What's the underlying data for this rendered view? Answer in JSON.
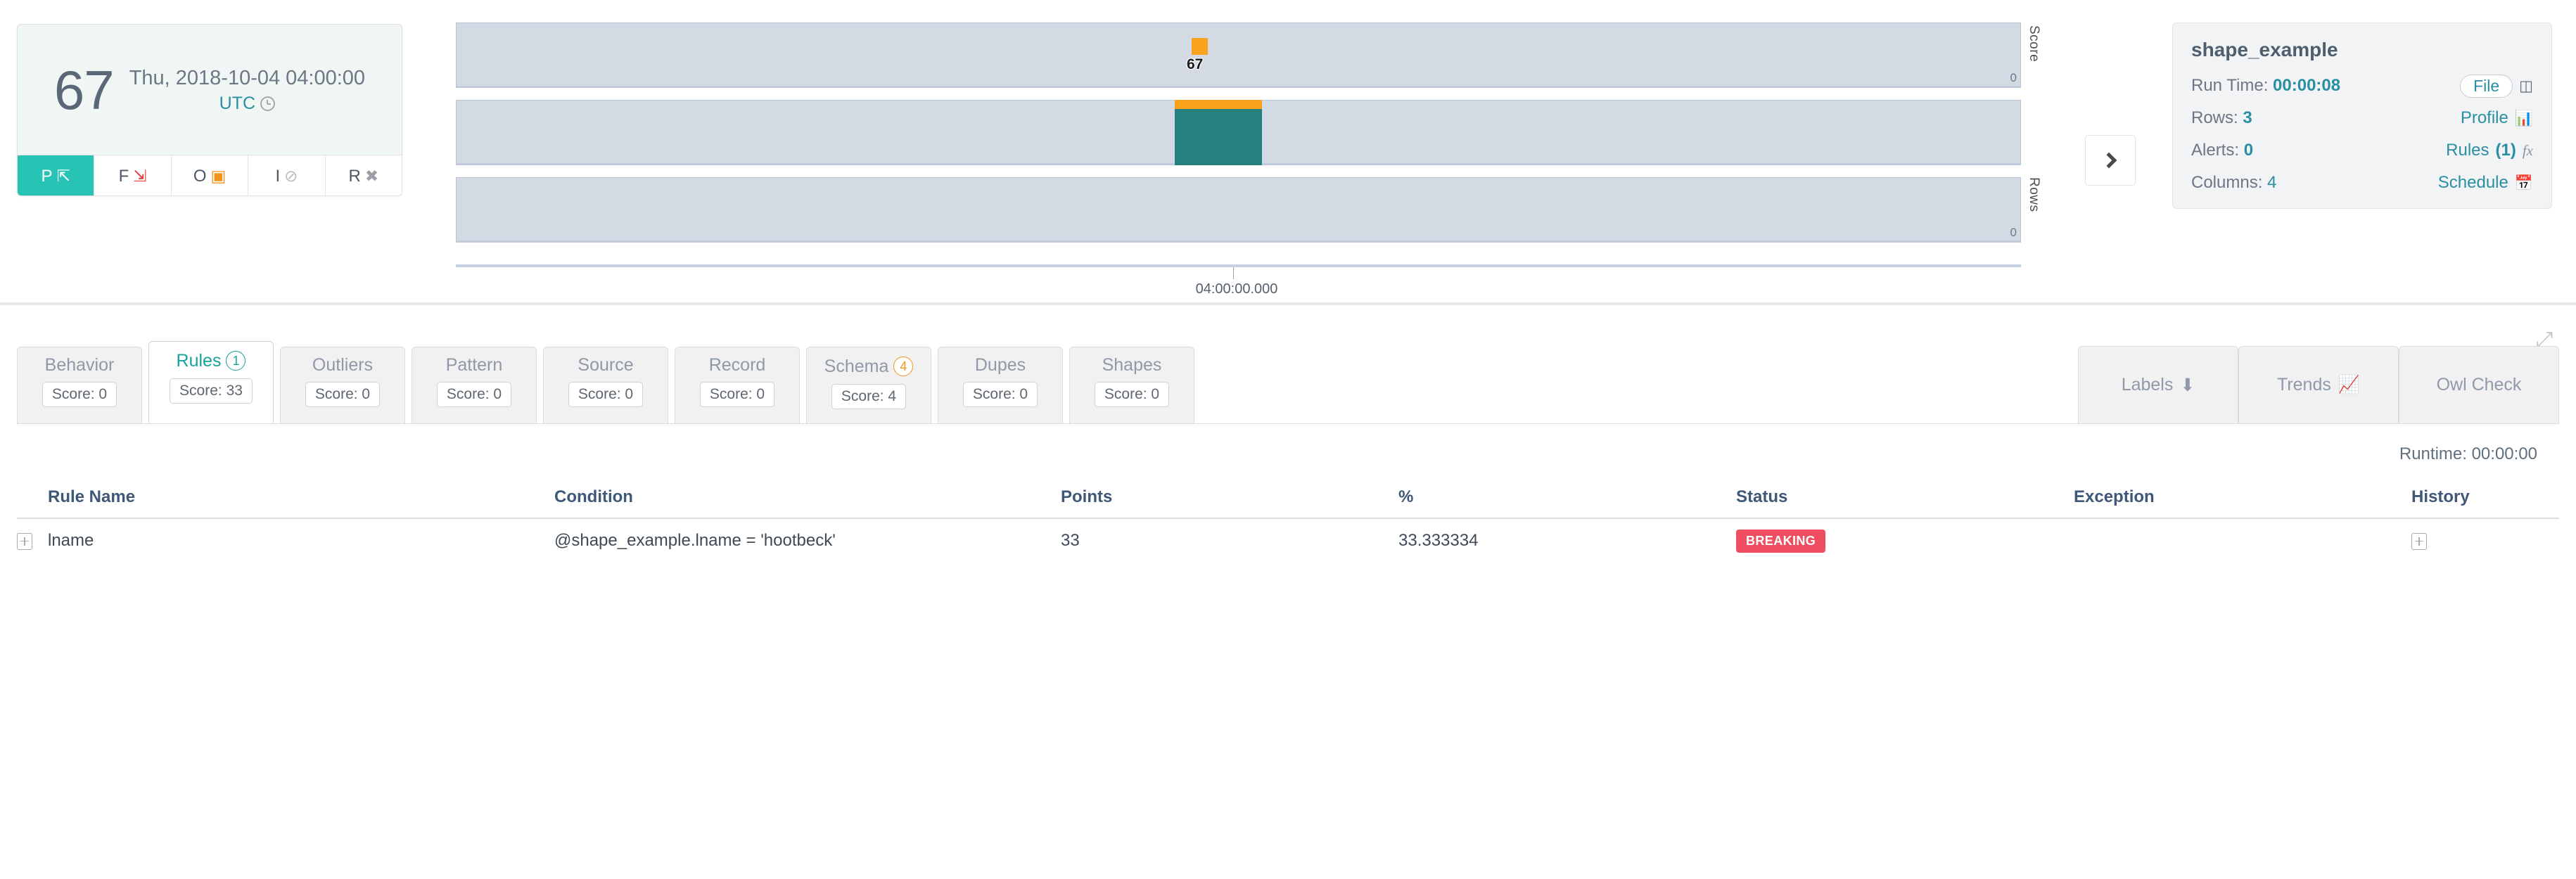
{
  "score_card": {
    "score": "67",
    "datetime": "Thu, 2018-10-04 04:00:00",
    "timezone": "UTC",
    "clock_icon": "clock-icon",
    "tabs": [
      {
        "label": "P",
        "icon": "arrow-up-right-icon",
        "glyph": "⤴",
        "active": true
      },
      {
        "label": "F",
        "icon": "arrow-down-red-icon",
        "glyph": "⤵",
        "active": false
      },
      {
        "label": "O",
        "icon": "calendar-x-icon",
        "glyph": "Ὄ5",
        "active": false
      },
      {
        "label": "I",
        "icon": "eye-slash-icon",
        "glyph": "ø",
        "active": false
      },
      {
        "label": "R",
        "icon": "close-x-icon",
        "glyph": "✖",
        "active": false
      }
    ]
  },
  "dataset_card": {
    "title": "shape_example",
    "rows": [
      {
        "label": "Run Time:",
        "value": "00:00:08",
        "action": "File",
        "action_type": "pill",
        "icon": "database-icon"
      },
      {
        "label": "Rows:",
        "value": "3",
        "action": "Profile",
        "action_type": "link",
        "icon": "bar-chart-icon"
      },
      {
        "label": "Alerts:",
        "value": "0",
        "action": "Rules",
        "action_count": "(1)",
        "action_type": "link",
        "icon": "fx-icon"
      },
      {
        "label": "Columns:",
        "value": "4",
        "value_plain": true,
        "action": "Schedule",
        "action_type": "link",
        "icon": "calendar-icon"
      }
    ]
  },
  "chart_data": {
    "type": "bar",
    "title": "",
    "xlabel": "",
    "x_tick_labels": [
      "04:00:00.000"
    ],
    "panels": [
      {
        "name": "Score",
        "ylabel": "Score",
        "ytick_label": "0",
        "ylim": [
          0,
          100
        ],
        "value": 67,
        "marker_label": "67",
        "marker_color": "#faa21b",
        "series_type": "scatter"
      },
      {
        "name": "Middle",
        "ylabel": "",
        "ytick_label": "",
        "value": 3,
        "bar_color": "#25807f",
        "cap_color": "#faa21b",
        "series_type": "bar"
      },
      {
        "name": "Rows",
        "ylabel": "Rows",
        "ytick_label": "0",
        "ylim": [
          0,
          3
        ],
        "value": 0,
        "series_type": "bar"
      }
    ],
    "grid": false,
    "legend": "none",
    "band_background": "#d3dae3"
  },
  "chart_controls": {
    "next_label": "next-period",
    "next_icon": "chevron-right-icon"
  },
  "tabs_section": {
    "expand_icon": "expand-arrows-icon",
    "tabs": [
      {
        "label": "Behavior",
        "score": "Score: 0",
        "badge": null,
        "active": false
      },
      {
        "label": "Rules",
        "score": "Score: 33",
        "badge": "1",
        "badge_color": "teal",
        "active": true
      },
      {
        "label": "Outliers",
        "score": "Score: 0",
        "badge": null,
        "active": false
      },
      {
        "label": "Pattern",
        "score": "Score: 0",
        "badge": null,
        "active": false
      },
      {
        "label": "Source",
        "score": "Score: 0",
        "badge": null,
        "active": false
      },
      {
        "label": "Record",
        "score": "Score: 0",
        "badge": null,
        "active": false
      },
      {
        "label": "Schema",
        "score": "Score: 4",
        "badge": "4",
        "badge_color": "orange",
        "active": false
      },
      {
        "label": "Dupes",
        "score": "Score: 0",
        "badge": null,
        "active": false
      },
      {
        "label": "Shapes",
        "score": "Score: 0",
        "badge": null,
        "active": false
      }
    ],
    "actions": [
      {
        "label": "Labels",
        "icon": "arrow-down-icon",
        "glyph": "⬇"
      },
      {
        "label": "Trends",
        "icon": "line-chart-icon",
        "glyph": "Ὄ8"
      },
      {
        "label": "Owl Check",
        "icon": null,
        "glyph": ""
      }
    ],
    "runtime": "Runtime: 00:00:00"
  },
  "rules_table": {
    "columns": [
      "Rule Name",
      "Condition",
      "Points",
      "%",
      "Status",
      "Exception",
      "History"
    ],
    "rows": [
      {
        "expand": "expand-row-icon",
        "rule_name": "lname",
        "condition": "@shape_example.lname = 'hootbeck'",
        "points": "33",
        "percent": "33.333334",
        "status": "BREAKING",
        "status_color": "#ee4e5f",
        "exception": "",
        "history": "expand-history-icon"
      }
    ]
  }
}
